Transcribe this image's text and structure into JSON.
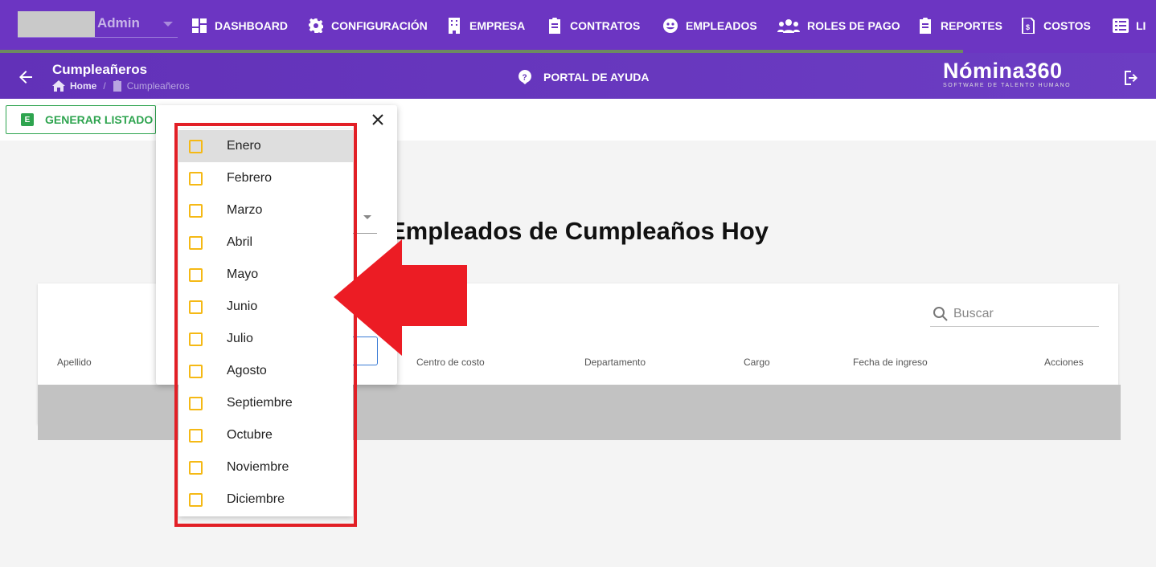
{
  "topnav": {
    "user_name": "Admin",
    "items": [
      {
        "label": "DASHBOARD",
        "icon": "dashboard-icon"
      },
      {
        "label": "CONFIGURACIÓN",
        "icon": "gear-icon"
      },
      {
        "label": "EMPRESA",
        "icon": "building-icon"
      },
      {
        "label": "CONTRATOS",
        "icon": "clipboard-icon"
      },
      {
        "label": "EMPLEADOS",
        "icon": "employees-icon"
      },
      {
        "label": "ROLES DE PAGO",
        "icon": "users-icon"
      },
      {
        "label": "REPORTES",
        "icon": "clipboard-icon"
      },
      {
        "label": "COSTOS",
        "icon": "invoice-icon"
      },
      {
        "label": "LI",
        "icon": "list-icon"
      }
    ]
  },
  "subheader": {
    "title": "Cumpleañeros",
    "breadcrumb_home": "Home",
    "breadcrumb_sep": "/",
    "breadcrumb_current": "Cumpleañeros",
    "help_label": "PORTAL DE AYUDA",
    "logo_wordmark": "Nómina360",
    "logo_tagline": "SOFTWARE DE TALENTO HUMANO"
  },
  "toolbar": {
    "generate_icon_letter": "E",
    "generate_label": "GENERAR LISTADO"
  },
  "main": {
    "title": "Empleados de Cumpleaños Hoy",
    "search_placeholder": "Buscar",
    "columns": [
      "Apellido",
      "Centro de costo",
      "Departamento",
      "Cargo",
      "Fecha de ingreso",
      "Acciones"
    ]
  },
  "dialog": {
    "close_glyph": "✕"
  },
  "months": {
    "items": [
      "Enero",
      "Febrero",
      "Marzo",
      "Abril",
      "Mayo",
      "Junio",
      "Julio",
      "Agosto",
      "Septiembre",
      "Octubre",
      "Noviembre",
      "Diciembre"
    ],
    "highlighted": "Enero"
  },
  "colors": {
    "nav_bg": "#6c35c2",
    "accent_green": "#2ea44f",
    "checkbox_border": "#f5b915",
    "highlight_red": "#e21f26"
  }
}
